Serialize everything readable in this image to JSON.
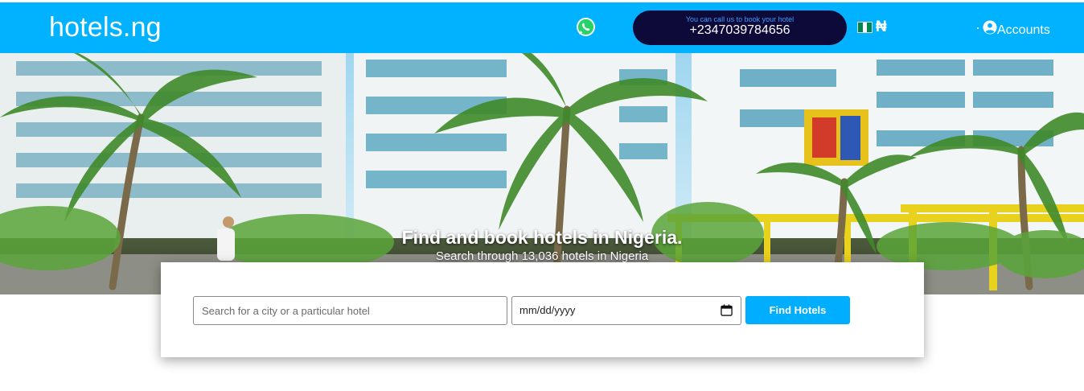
{
  "header": {
    "logo": "hotels.ng",
    "whatsapp_icon": "whatsapp-icon",
    "call_hint": "You can call us to book your hotel",
    "phone": "+2347039784656",
    "flag_icon": "nigeria-flag-icon",
    "currency_symbol": "₦",
    "accounts_label": "Accounts",
    "account_icon": "user-circle-icon",
    "bar_color": "#00b2ff",
    "pill_color": "#0d0a3a"
  },
  "hero": {
    "title": "Find and book hotels in Nigeria.",
    "subtitle": "Search through 13,036 hotels in Nigeria"
  },
  "search": {
    "placeholder": "Search for a city or a particular hotel",
    "date_placeholder": "mm/dd/yyyy",
    "calendar_icon": "calendar-icon",
    "button_label": "Find Hotels",
    "button_color": "#00aeff"
  }
}
